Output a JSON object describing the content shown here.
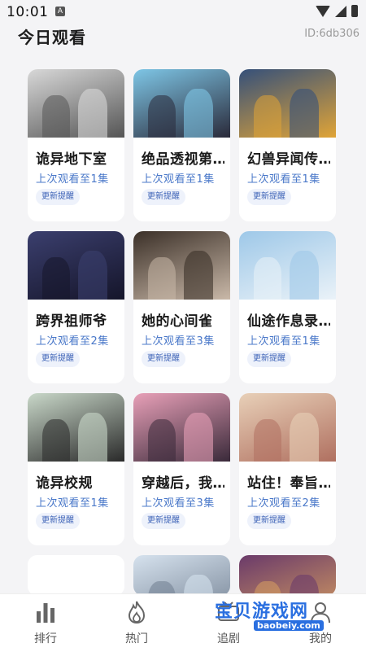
{
  "status_bar": {
    "time": "10:01",
    "notification_letter": "A"
  },
  "header": {
    "title": "今日观看",
    "user_id": "ID:6db306"
  },
  "cards": [
    {
      "title": "诡异地下室",
      "progress": "上次观看至1集",
      "remind_label": "更新提醒",
      "colors": [
        "#d8d8d8",
        "#555555"
      ]
    },
    {
      "title": "绝品透视第…",
      "progress": "上次观看至1集",
      "remind_label": "更新提醒",
      "colors": [
        "#7ec6e6",
        "#2a2a3a"
      ]
    },
    {
      "title": "幻兽异闻传…",
      "progress": "上次观看至1集",
      "remind_label": "更新提醒",
      "colors": [
        "#35507a",
        "#e0a437"
      ]
    },
    {
      "title": "跨界祖师爷",
      "progress": "上次观看至2集",
      "remind_label": "更新提醒",
      "colors": [
        "#3b3f6e",
        "#15152a"
      ]
    },
    {
      "title": "她的心间雀",
      "progress": "上次观看至3集",
      "remind_label": "更新提醒",
      "colors": [
        "#3b3028",
        "#c9b8a8"
      ]
    },
    {
      "title": "仙途作息录…",
      "progress": "上次观看至1集",
      "remind_label": "更新提醒",
      "colors": [
        "#9ec8e8",
        "#eaf2f8"
      ]
    },
    {
      "title": "诡异校规",
      "progress": "上次观看至1集",
      "remind_label": "更新提醒",
      "colors": [
        "#c9d8c9",
        "#2a2a2a"
      ]
    },
    {
      "title": "穿越后，我…",
      "progress": "上次观看至3集",
      "remind_label": "更新提醒",
      "colors": [
        "#e8a0b8",
        "#3a2a3a"
      ]
    },
    {
      "title": "站住！奉旨…",
      "progress": "上次观看至2集",
      "remind_label": "更新提醒",
      "colors": [
        "#e8d0b8",
        "#b07060"
      ]
    },
    {
      "title": "",
      "progress": "",
      "remind_label": "",
      "colors": [
        "#ffffff",
        "#ffffff"
      ]
    },
    {
      "title": "",
      "progress": "",
      "remind_label": "",
      "colors": [
        "#d6e2ee",
        "#6f7d8f"
      ]
    },
    {
      "title": "",
      "progress": "",
      "remind_label": "",
      "colors": [
        "#6a3a6a",
        "#d8a060"
      ]
    }
  ],
  "tabbar": {
    "items": [
      {
        "label": "排行",
        "icon": "bar-chart-icon"
      },
      {
        "label": "热门",
        "icon": "flame-icon"
      },
      {
        "label": "追剧",
        "icon": "tv-icon"
      },
      {
        "label": "我的",
        "icon": "user-icon"
      }
    ]
  },
  "watermark": {
    "text": "宝贝游戏网",
    "domain": "baobeiy.com"
  }
}
